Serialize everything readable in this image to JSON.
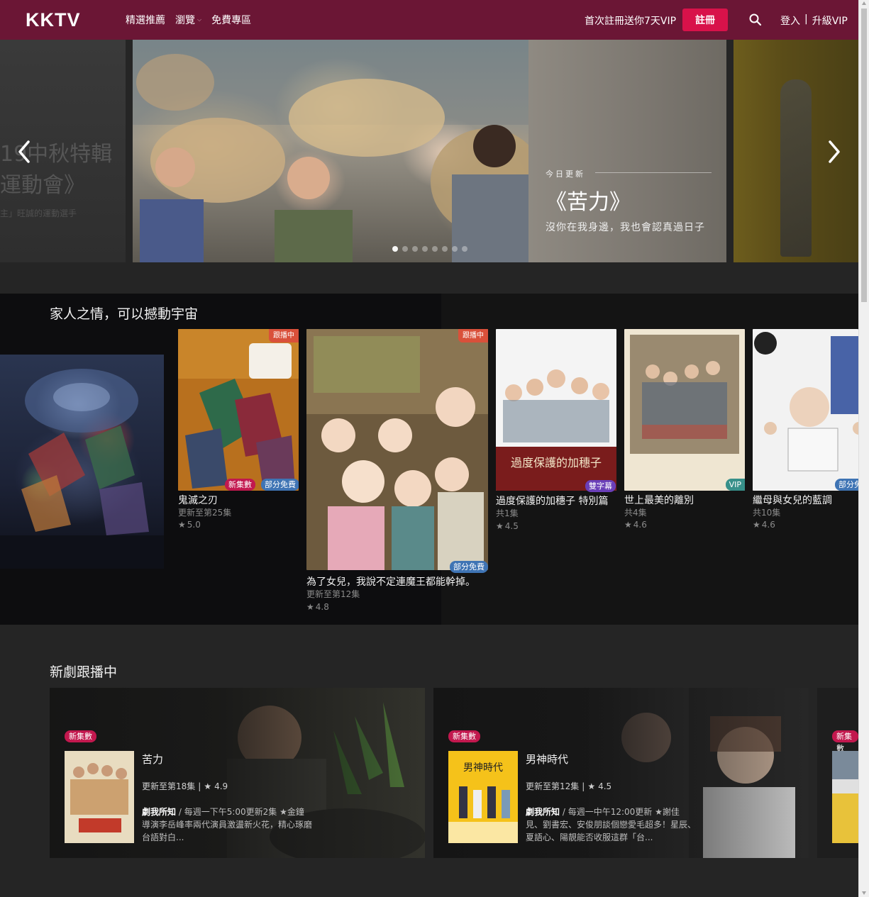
{
  "header": {
    "logo": "KKTV",
    "nav": [
      {
        "label": "精選推薦"
      },
      {
        "label": "瀏覽"
      },
      {
        "label": "免費專區"
      }
    ],
    "promo": "首次註冊送你7天VIP",
    "register": "註冊",
    "login": "登入",
    "separator": "|",
    "upgrade": "升級VIP"
  },
  "hero": {
    "prev_title_line1": "19中秋特輯",
    "prev_title_line2": "運動會》",
    "prev_subtitle": "主」旺誠的運動選手",
    "kicker": "今日更新",
    "title": "《苦力》",
    "description": "沒你在我身邊，我也會認真過日子",
    "dots": 8,
    "active_dot": 0
  },
  "section1": {
    "title": "家人之情，可以撼動宇宙",
    "cards": [
      {
        "title": "鬼滅之刃",
        "sub": "更新至第25集",
        "rating": "5.0",
        "corner": "跟播中",
        "badges": [
          "新集數",
          "部分免費"
        ]
      },
      {
        "title": "為了女兒，我說不定連魔王都能幹掉。",
        "sub": "更新至第12集",
        "rating": "4.8",
        "corner": "跟播中",
        "badges": [
          "部分免費"
        ]
      },
      {
        "title": "過度保護的加穗子 特別篇",
        "sub": "共1集",
        "rating": "4.5",
        "badges": [
          "雙字幕"
        ]
      },
      {
        "title": "世上最美的離別",
        "sub": "共4集",
        "rating": "4.6",
        "badges": [
          "VIP"
        ]
      },
      {
        "title": "繼母與女兒的藍調",
        "sub": "共10集",
        "rating": "4.6",
        "badges": [
          "部分免費"
        ]
      }
    ]
  },
  "section2": {
    "title": "新劇跟播中",
    "cards": [
      {
        "badge": "新集數",
        "title": "苦力",
        "meta": "更新至第18集",
        "rating": "4.9",
        "desc_label": "劇我所知",
        "desc": " / 每週一下午5:00更新2集 ★金鐘導演李岳峰率兩代演員激盪新火花，精心琢磨台語對白..."
      },
      {
        "badge": "新集數",
        "title": "男神時代",
        "meta": "更新至第12集",
        "rating": "4.5",
        "desc_label": "劇我所知",
        "desc": " / 每週一中午12:00更新 ★謝佳見、劉書宏、安俊朋談個戀愛毛超多！星辰、夏語心、陽靚能否收服這群「台..."
      },
      {
        "badge": "新集數",
        "title": "",
        "meta": "",
        "rating": "",
        "desc_label": "",
        "desc": ""
      }
    ]
  },
  "colors": {
    "header_bg": "#6b1635",
    "accent": "#d8124a",
    "page_bg": "#252525",
    "section_bg": "#141414"
  },
  "icons": {
    "search": "search-icon",
    "prev": "chevron-left-icon",
    "next": "chevron-right-icon",
    "star": "star-icon"
  }
}
